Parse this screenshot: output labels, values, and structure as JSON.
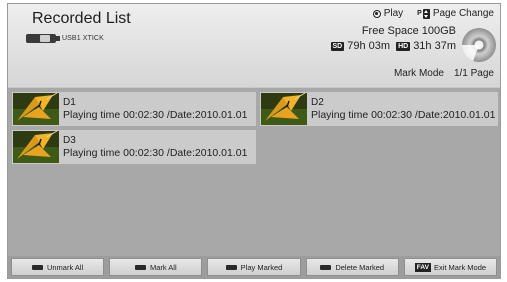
{
  "header": {
    "title": "Recorded List",
    "usb_label": "USB1 XTICK",
    "play_label": "Play",
    "page_change_label": "Page Change",
    "free_space": "Free Space 100GB",
    "sd_tag": "SD",
    "sd_time": "79h 03m",
    "hd_tag": "HD",
    "hd_time": "31h 37m",
    "mark_mode": "Mark Mode",
    "page_indicator": "1/1 Page"
  },
  "icons": {
    "play": "radio-dot-icon",
    "page_change": "page-up-down-icon",
    "usb": "usb-icon",
    "disc": "disc-usage-icon"
  },
  "recordings": [
    {
      "title": "D1",
      "info": "Playing time 00:02:30 /Date:2010.01.01"
    },
    {
      "title": "D2",
      "info": "Playing time 00:02:30 /Date:2010.01.01"
    },
    {
      "title": "D3",
      "info": "Playing time 00:02:30 /Date:2010.01.01"
    }
  ],
  "footer": {
    "unmark_all": "Unmark All",
    "mark_all": "Mark All",
    "play_marked": "Play Marked",
    "delete_marked": "Delete Marked",
    "fav_tag": "FAV",
    "exit_mark_mode": "Exit Mark Mode"
  },
  "colors": {
    "panel": "#a8a8a8",
    "header": "#e2e2e2",
    "item": "#cbcbcb",
    "text": "#222222"
  }
}
